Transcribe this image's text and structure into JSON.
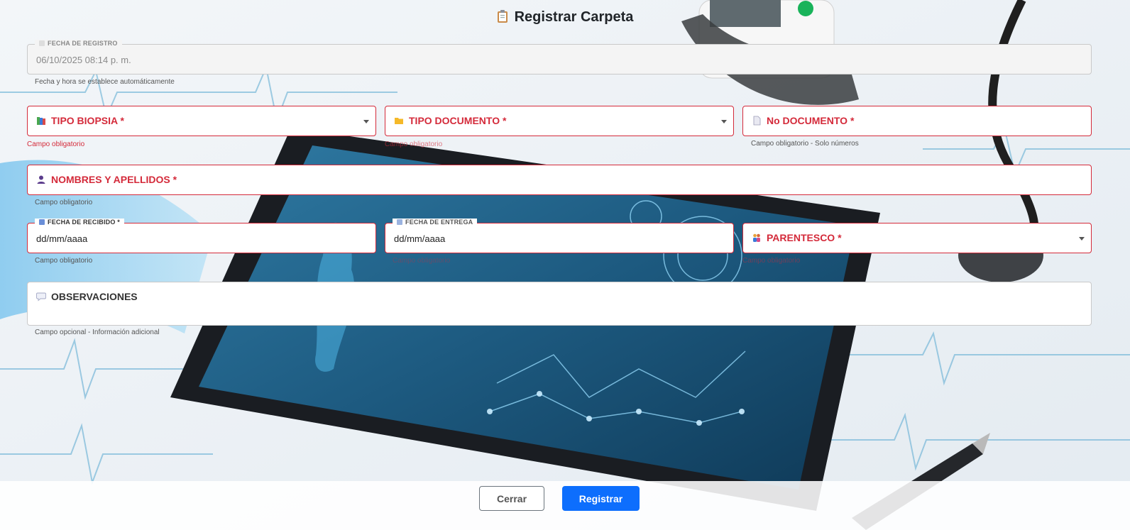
{
  "header": {
    "title": "Registrar Carpeta",
    "icon": "clipboard-icon"
  },
  "fields": {
    "fecha_registro": {
      "label": "FECHA DE REGISTRO",
      "value": "06/10/2025 08:14 p. m.",
      "help": "Fecha y hora se establece automáticamente"
    },
    "tipo_biopsia": {
      "label": "TIPO BIOPSIA *",
      "icon": "books-icon",
      "help": "Campo obligatorio"
    },
    "tipo_documento": {
      "label": "TIPO DOCUMENTO *",
      "icon": "folder-icon",
      "help": "Campo obligatorio"
    },
    "no_documento": {
      "label": "No DOCUMENTO *",
      "icon": "page-icon",
      "help": "Campo obligatorio - Solo números"
    },
    "nombres": {
      "label": "NOMBRES Y APELLIDOS *",
      "icon": "person-icon",
      "help": "Campo obligatorio"
    },
    "fecha_recibido": {
      "label": "FECHA DE RECIBIDO *",
      "placeholder": "dd/mm/aaaa",
      "help": "Campo obligatorio"
    },
    "fecha_entrega": {
      "label": "FECHA DE ENTREGA",
      "placeholder": "dd/mm/aaaa",
      "help": "Campo obligatorio"
    },
    "parentesco": {
      "label": "PARENTESCO *",
      "icon": "people-icon",
      "help": "Campo obligatorio"
    },
    "observaciones": {
      "label": "OBSERVACIONES",
      "icon": "speech-bubble-icon",
      "help": "Campo opcional - Información adicional"
    }
  },
  "footer": {
    "close_label": "Cerrar",
    "submit_label": "Registrar"
  },
  "colors": {
    "required": "#d42a3a",
    "primary": "#0d6efd"
  }
}
